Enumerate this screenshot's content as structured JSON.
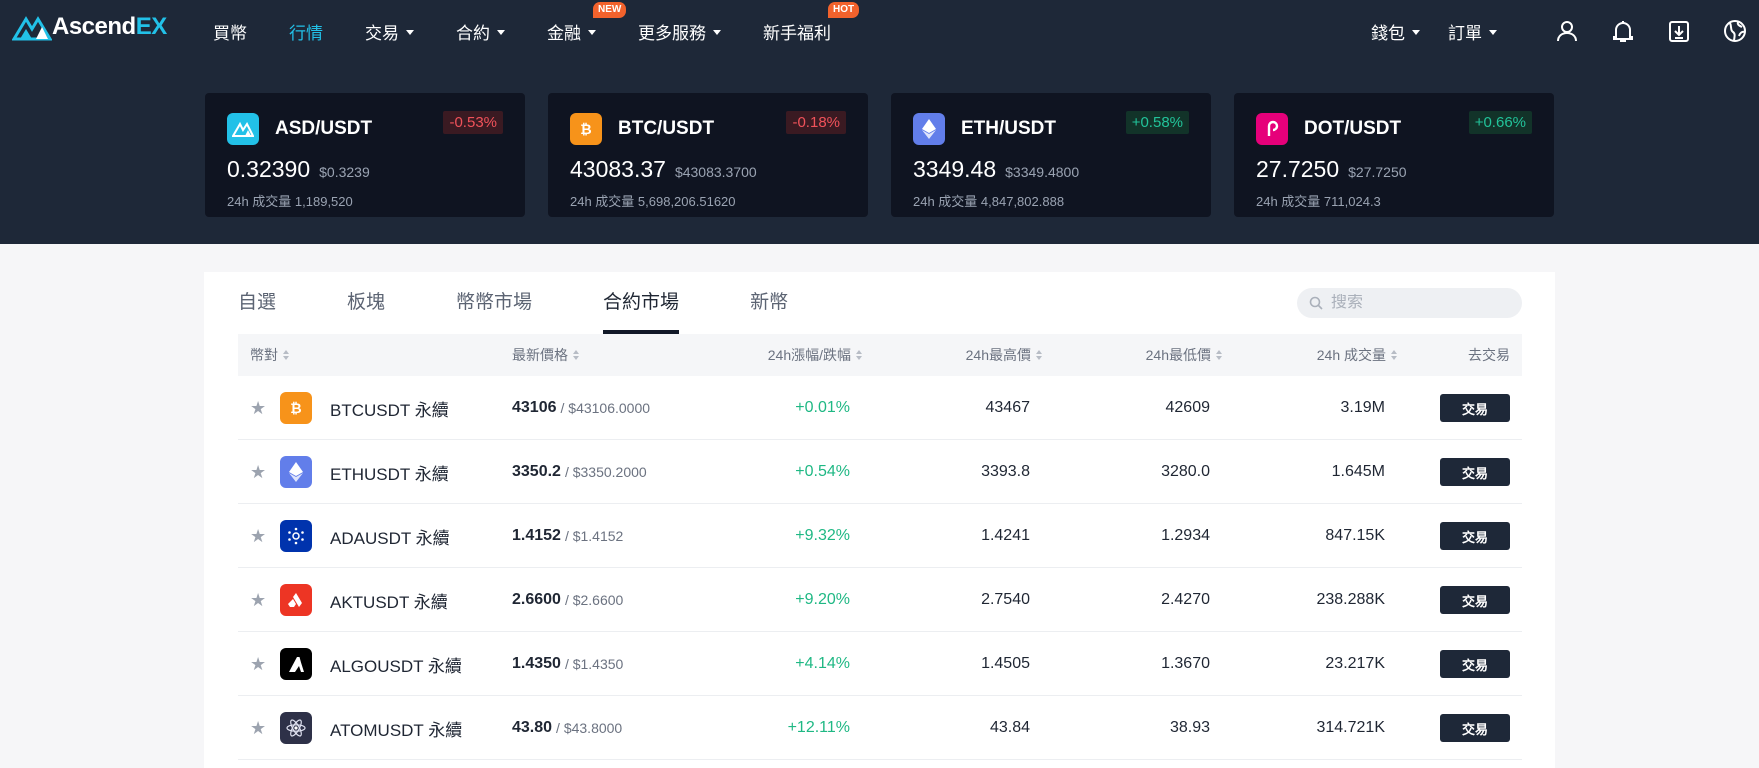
{
  "brand": {
    "logo_text_a": "Ascend",
    "logo_text_b": "EX"
  },
  "nav": {
    "items": [
      {
        "label": "買幣",
        "active": false,
        "caret": false
      },
      {
        "label": "行情",
        "active": true,
        "caret": false
      },
      {
        "label": "交易",
        "active": false,
        "caret": true
      },
      {
        "label": "合約",
        "active": false,
        "caret": true
      },
      {
        "label": "金融",
        "active": false,
        "caret": true,
        "badge": "NEW"
      },
      {
        "label": "更多服務",
        "active": false,
        "caret": true
      },
      {
        "label": "新手福利",
        "active": false,
        "caret": false,
        "badge": "HOT"
      }
    ],
    "right": {
      "wallet": "錢包",
      "orders": "訂單"
    }
  },
  "tickers": [
    {
      "pair": "ASD/USDT",
      "change": "-0.53%",
      "dir": "neg",
      "price": "0.32390",
      "usd": "$0.3239",
      "volume": "24h 成交量 1,189,520",
      "icon": "ascendex-icon",
      "color": "#22c1e8"
    },
    {
      "pair": "BTC/USDT",
      "change": "-0.18%",
      "dir": "neg",
      "price": "43083.37",
      "usd": "$43083.3700",
      "volume": "24h 成交量 5,698,206.51620",
      "icon": "bitcoin-icon",
      "color": "#f7931a"
    },
    {
      "pair": "ETH/USDT",
      "change": "+0.58%",
      "dir": "pos",
      "price": "3349.48",
      "usd": "$3349.4800",
      "volume": "24h 成交量 4,847,802.888",
      "icon": "ethereum-icon",
      "color": "#627eea"
    },
    {
      "pair": "DOT/USDT",
      "change": "+0.66%",
      "dir": "pos",
      "price": "27.7250",
      "usd": "$27.7250",
      "volume": "24h 成交量 711,024.3",
      "icon": "polkadot-icon",
      "color": "#e6007a"
    }
  ],
  "tabs": [
    {
      "label": "自選",
      "active": false
    },
    {
      "label": "板塊",
      "active": false
    },
    {
      "label": "幣幣市場",
      "active": false
    },
    {
      "label": "合約市場",
      "active": true
    },
    {
      "label": "新幣",
      "active": false
    }
  ],
  "search": {
    "placeholder": "搜索"
  },
  "table": {
    "headers": {
      "pair": "幣對",
      "last_price": "最新價格",
      "change": "24h漲幅/跌幅",
      "high": "24h最高價",
      "low": "24h最低價",
      "volume": "24h 成交量",
      "trade": "去交易"
    },
    "trade_label": "交易",
    "rows": [
      {
        "symbol": "BTCUSDT 永續",
        "price": "43106",
        "usd": "/ $43106.0000",
        "change": "+0.01%",
        "high": "43467",
        "low": "42609",
        "volume": "3.19M",
        "icon": "bitcoin-icon",
        "color": "#f7931a"
      },
      {
        "symbol": "ETHUSDT 永續",
        "price": "3350.2",
        "usd": "/ $3350.2000",
        "change": "+0.54%",
        "high": "3393.8",
        "low": "3280.0",
        "volume": "1.645M",
        "icon": "ethereum-icon",
        "color": "#627eea"
      },
      {
        "symbol": "ADAUSDT 永續",
        "price": "1.4152",
        "usd": "/ $1.4152",
        "change": "+9.32%",
        "high": "1.4241",
        "low": "1.2934",
        "volume": "847.15K",
        "icon": "cardano-icon",
        "color": "#0033ad"
      },
      {
        "symbol": "AKTUSDT 永續",
        "price": "2.6600",
        "usd": "/ $2.6600",
        "change": "+9.20%",
        "high": "2.7540",
        "low": "2.4270",
        "volume": "238.288K",
        "icon": "akash-icon",
        "color": "#ed3524"
      },
      {
        "symbol": "ALGOUSDT 永續",
        "price": "1.4350",
        "usd": "/ $1.4350",
        "change": "+4.14%",
        "high": "1.4505",
        "low": "1.3670",
        "volume": "23.217K",
        "icon": "algorand-icon",
        "color": "#000000"
      },
      {
        "symbol": "ATOMUSDT 永續",
        "price": "43.80",
        "usd": "/ $43.8000",
        "change": "+12.11%",
        "high": "43.84",
        "low": "38.93",
        "volume": "314.721K",
        "icon": "cosmos-icon",
        "color": "#2e3148"
      }
    ]
  }
}
